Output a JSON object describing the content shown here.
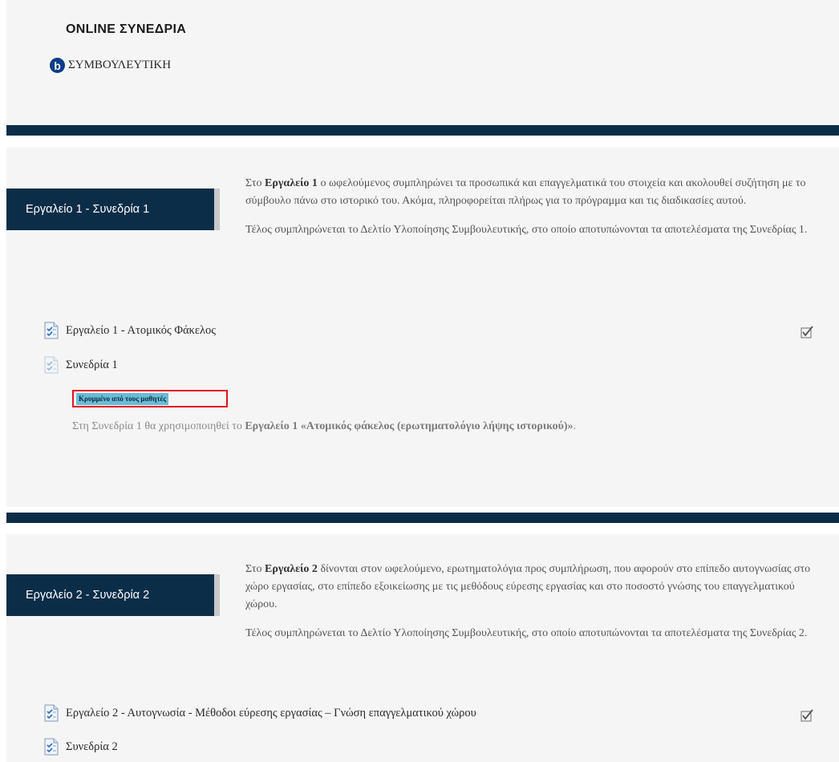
{
  "header": {
    "title": "ONLINE ΣΥΝΕΔΡΙΑ",
    "course_logo_letter": "b",
    "course_name": "ΣΥΜΒΟΥΛΕΥΤΙΚΗ"
  },
  "sections": [
    {
      "tag": "Εργαλείο 1 - Συνεδρία 1",
      "desc1_a": "Στο ",
      "desc1_b": "Εργαλείο 1",
      "desc1_c": " ο ωφελούμενος συμπληρώνει τα προσωπικά και επαγγελματικά του στοιχεία και ακολουθεί συζήτηση με το σύμβουλο πάνω στο ιστορικό του. Ακόμα, πληροφορείται πλήρως για το πρόγραμμα και τις διαδικασίες αυτού.",
      "desc2": "Τέλος συμπληρώνεται το Δελτίο Υλοποίησης Συμβουλευτικής, στο οποίο αποτυπώνονται τα αποτελέσματα της  Συνεδρίας 1.",
      "activity1": "Εργαλείο 1 - Ατομικός Φάκελος",
      "activity2": "Συνεδρία 1",
      "hidden_badge": "Κρυμμένο από τους μαθητές",
      "act_desc_a": "Στη Συνεδρία 1 θα χρησιμοποιηθεί το ",
      "act_desc_b": "Εργαλείο 1 «Ατομικός φάκελος (ερωτηματολόγιο λήψης ιστορικού)»",
      "act_desc_c": "."
    },
    {
      "tag": "Εργαλείο 2 - Συνεδρία 2",
      "desc1_a": "Στο ",
      "desc1_b": "Εργαλείο 2",
      "desc1_c": " δίνονται στον ωφελούμενο, ερωτηματολόγια προς συμπλήρωση, που αφορούν στο επίπεδο αυτογνωσίας στο χώρο εργασίας, στο επίπεδο εξοικείωσης με  τις μεθόδους εύρεσης εργασίας και στο ποσοστό γνώσης του επαγγελματικού χώρου.",
      "desc2": "Τέλος συμπληρώνεται το Δελτίο Υλοποίησης Συμβουλευτικής, στο οποίο αποτυπώνονται τα αποτελέσματα της  Συνεδρίας 2.",
      "activity1": "Εργαλείο 2 - Αυτογνωσία - Μέθοδοι εύρεσης εργασίας – Γνώση επαγγελματικού χώρου",
      "activity2": "Συνεδρία 2"
    }
  ],
  "colors": {
    "dark_navy": "#0c2d48",
    "hidden_badge_bg": "#69bcd8",
    "highlight_border": "#e2131b"
  }
}
